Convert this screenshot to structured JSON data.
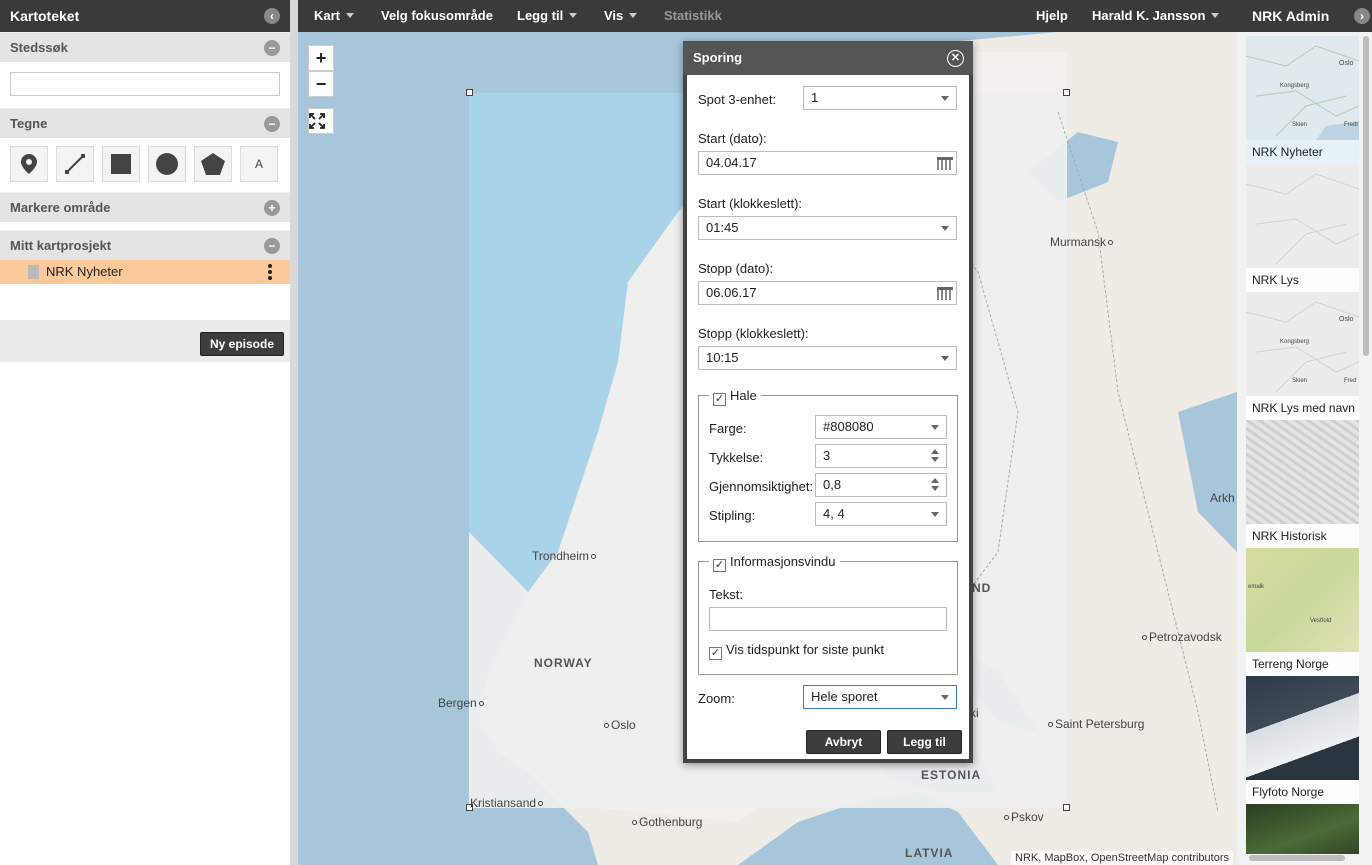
{
  "left_panel": {
    "title": "Kartoteket",
    "sections": {
      "stedssok": "Stedssøk",
      "tegne": "Tegne",
      "markere": "Markere område",
      "prosjekt": "Mitt kartprosjekt"
    },
    "search_value": "",
    "draw_tool_text": "A",
    "project_item": "NRK Nyheter",
    "new_episode": "Ny episode"
  },
  "topbar": {
    "kart": "Kart",
    "fokus": "Velg fokusområde",
    "leggtil": "Legg til",
    "vis": "Vis",
    "statistikk": "Statistikk",
    "hjelp": "Hjelp",
    "user": "Harald K. Jansson"
  },
  "map": {
    "zoom_in": "+",
    "zoom_out": "−",
    "cities": {
      "murmansk": "Murmansk",
      "trondheim": "Trondheim",
      "bergen": "Bergen",
      "oslo": "Oslo",
      "kristiansand": "Kristiansand",
      "gothenburg": "Gothenburg",
      "petrozavodsk": "Petrozavodsk",
      "stpetersburg": "Saint Petersburg",
      "pskov": "Pskov",
      "arkh": "Arkh"
    },
    "countries": {
      "norway": "NORWAY",
      "estonia": "ESTONIA",
      "latvia": "LATVIA",
      "nd": "ND",
      "ki": "ki"
    },
    "attribution": "NRK, MapBox, OpenStreetMap contributors"
  },
  "right_panel": {
    "title": "NRK Admin",
    "thumbs": [
      {
        "label": "NRK Nyheter",
        "color": "#dfe9ee"
      },
      {
        "label": "NRK Lys",
        "color": "#ececec"
      },
      {
        "label": "NRK Lys med navn",
        "color": "#ececec"
      },
      {
        "label": "NRK Historisk",
        "color": "#d6d6d6"
      },
      {
        "label": "Terreng Norge",
        "color": "#d8dca0"
      },
      {
        "label": "Flyfoto Norge",
        "color": "#3a4450"
      }
    ],
    "thumb_texts": {
      "oslo1": "Oslo",
      "kongsberg1": "Kongsberg",
      "skien1": "Skien",
      "fred1": "Fredr",
      "oslo2": "Oslo",
      "kongsberg2": "Kongsberg",
      "skien2": "Skien",
      "fred2": "Fred",
      "emalk": "emalk",
      "vestfold": "Vestfold"
    }
  },
  "dialog": {
    "title": "Sporing",
    "spot_label": "Spot 3-enhet:",
    "spot_value": "1",
    "start_date_label": "Start (dato):",
    "start_date_value": "04.04.17",
    "start_time_label": "Start (klokkeslett):",
    "start_time_value": "01:45",
    "stop_date_label": "Stopp (dato):",
    "stop_date_value": "06.06.17",
    "stop_time_label": "Stopp (klokkeslett):",
    "stop_time_value": "10:15",
    "hale": {
      "legend": "Hale",
      "farge_label": "Farge:",
      "farge_value": "#808080",
      "tykkelse_label": "Tykkelse:",
      "tykkelse_value": "3",
      "gjennom_label": "Gjennomsiktighet:",
      "gjennom_value": "0,8",
      "stipling_label": "Stipling:",
      "stipling_value": "4, 4"
    },
    "info": {
      "legend": "Informasjonsvindu",
      "tekst_label": "Tekst:",
      "tekst_value": "",
      "vis_label": "Vis tidspunkt for siste punkt"
    },
    "zoom_label": "Zoom:",
    "zoom_value": "Hele sporet",
    "cancel": "Avbryt",
    "add": "Legg til"
  },
  "check_glyph": "✓",
  "colors": {
    "accent_selected": "#fcc99a",
    "bar_dark": "#3a3a3a",
    "water": "#a8c6da",
    "land": "#efece6"
  }
}
